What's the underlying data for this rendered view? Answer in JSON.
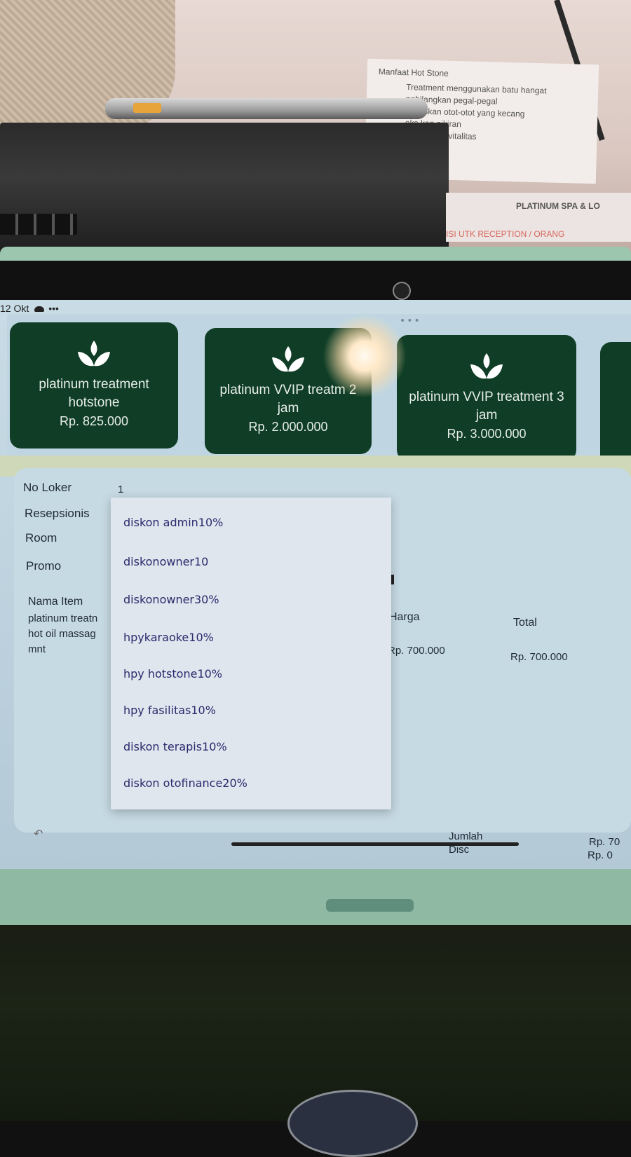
{
  "environment": {
    "note_card": {
      "title": "Manfaat Hot Stone",
      "lines": [
        "Treatment menggunakan batu hangat",
        "nghilangkan pegal-pegal",
        "lemaskan otot-otot yang kecang",
        "eks kan pikiran",
        "i Re-energi vitalitas"
      ]
    },
    "sign": {
      "line1": "PLATINUM SPA & LO",
      "line2": "ISI UTK RECEPTION / ORANG"
    }
  },
  "statusbar": {
    "date": "12 Okt",
    "more": "•••"
  },
  "top_handle": "•••",
  "treatments": [
    {
      "name": "platinum treatment hotstone",
      "price": "Rp. 825.000"
    },
    {
      "name": "platinum VVIP treatm 2 jam",
      "price": "Rp. 2.000.000"
    },
    {
      "name": "platinum VVIP treatment 3 jam",
      "price": "Rp. 3.000.000"
    }
  ],
  "form": {
    "no_loker_label": "No Loker",
    "no_loker_value": "1",
    "resepsionis_label": "Resepsionis",
    "room_label": "Room",
    "promo_label": "Promo"
  },
  "items_table": {
    "col_name": "Nama Item",
    "col_harga": "Harga",
    "col_total": "Total",
    "rows": [
      {
        "name_line1": "platinum treatn",
        "name_line2": "hot oil massag",
        "name_line3": "mnt",
        "harga": "Rp. 700.000",
        "total": "Rp. 700.000"
      }
    ]
  },
  "summary": {
    "jumlah_label": "Jumlah",
    "disc_label": "Disc",
    "jumlah_value": "Rp. 70",
    "disc_value": "Rp. 0"
  },
  "promo_dropdown": {
    "options": [
      "diskon admin10%",
      "diskonowner10",
      "diskonowner30%",
      "hpykaraoke10%",
      "hpy hotstone10%",
      "hpy fasilitas10%",
      "diskon terapis10%",
      "diskon otofinance20%"
    ]
  },
  "colors": {
    "card_bg": "#0f3d26",
    "screen_bg": "#c9dce6",
    "dropdown_text": "#2a2a6b"
  }
}
